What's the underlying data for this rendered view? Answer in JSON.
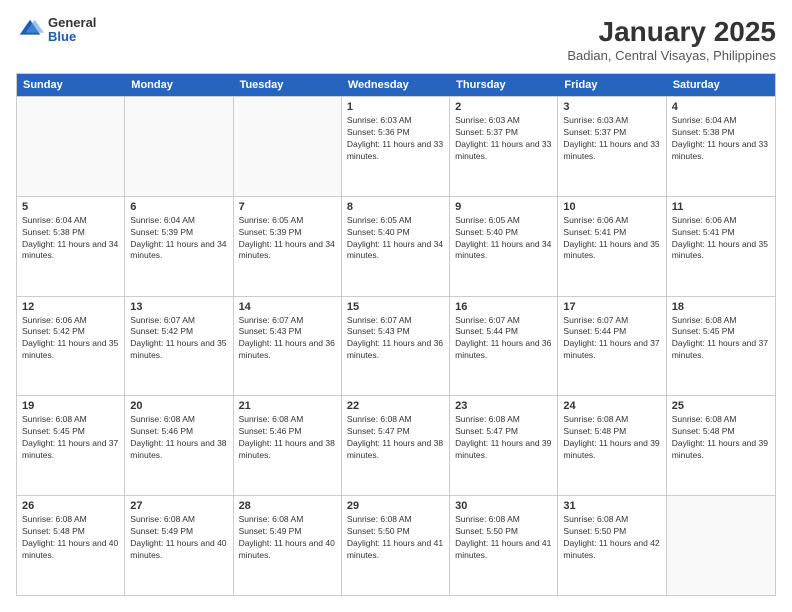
{
  "logo": {
    "general": "General",
    "blue": "Blue"
  },
  "title": "January 2025",
  "location": "Badian, Central Visayas, Philippines",
  "days": [
    "Sunday",
    "Monday",
    "Tuesday",
    "Wednesday",
    "Thursday",
    "Friday",
    "Saturday"
  ],
  "weeks": [
    [
      {
        "date": "",
        "empty": true
      },
      {
        "date": "",
        "empty": true
      },
      {
        "date": "",
        "empty": true
      },
      {
        "date": "1",
        "sunrise": "Sunrise: 6:03 AM",
        "sunset": "Sunset: 5:36 PM",
        "daylight": "Daylight: 11 hours and 33 minutes."
      },
      {
        "date": "2",
        "sunrise": "Sunrise: 6:03 AM",
        "sunset": "Sunset: 5:37 PM",
        "daylight": "Daylight: 11 hours and 33 minutes."
      },
      {
        "date": "3",
        "sunrise": "Sunrise: 6:03 AM",
        "sunset": "Sunset: 5:37 PM",
        "daylight": "Daylight: 11 hours and 33 minutes."
      },
      {
        "date": "4",
        "sunrise": "Sunrise: 6:04 AM",
        "sunset": "Sunset: 5:38 PM",
        "daylight": "Daylight: 11 hours and 33 minutes."
      }
    ],
    [
      {
        "date": "5",
        "sunrise": "Sunrise: 6:04 AM",
        "sunset": "Sunset: 5:38 PM",
        "daylight": "Daylight: 11 hours and 34 minutes."
      },
      {
        "date": "6",
        "sunrise": "Sunrise: 6:04 AM",
        "sunset": "Sunset: 5:39 PM",
        "daylight": "Daylight: 11 hours and 34 minutes."
      },
      {
        "date": "7",
        "sunrise": "Sunrise: 6:05 AM",
        "sunset": "Sunset: 5:39 PM",
        "daylight": "Daylight: 11 hours and 34 minutes."
      },
      {
        "date": "8",
        "sunrise": "Sunrise: 6:05 AM",
        "sunset": "Sunset: 5:40 PM",
        "daylight": "Daylight: 11 hours and 34 minutes."
      },
      {
        "date": "9",
        "sunrise": "Sunrise: 6:05 AM",
        "sunset": "Sunset: 5:40 PM",
        "daylight": "Daylight: 11 hours and 34 minutes."
      },
      {
        "date": "10",
        "sunrise": "Sunrise: 6:06 AM",
        "sunset": "Sunset: 5:41 PM",
        "daylight": "Daylight: 11 hours and 35 minutes."
      },
      {
        "date": "11",
        "sunrise": "Sunrise: 6:06 AM",
        "sunset": "Sunset: 5:41 PM",
        "daylight": "Daylight: 11 hours and 35 minutes."
      }
    ],
    [
      {
        "date": "12",
        "sunrise": "Sunrise: 6:06 AM",
        "sunset": "Sunset: 5:42 PM",
        "daylight": "Daylight: 11 hours and 35 minutes."
      },
      {
        "date": "13",
        "sunrise": "Sunrise: 6:07 AM",
        "sunset": "Sunset: 5:42 PM",
        "daylight": "Daylight: 11 hours and 35 minutes."
      },
      {
        "date": "14",
        "sunrise": "Sunrise: 6:07 AM",
        "sunset": "Sunset: 5:43 PM",
        "daylight": "Daylight: 11 hours and 36 minutes."
      },
      {
        "date": "15",
        "sunrise": "Sunrise: 6:07 AM",
        "sunset": "Sunset: 5:43 PM",
        "daylight": "Daylight: 11 hours and 36 minutes."
      },
      {
        "date": "16",
        "sunrise": "Sunrise: 6:07 AM",
        "sunset": "Sunset: 5:44 PM",
        "daylight": "Daylight: 11 hours and 36 minutes."
      },
      {
        "date": "17",
        "sunrise": "Sunrise: 6:07 AM",
        "sunset": "Sunset: 5:44 PM",
        "daylight": "Daylight: 11 hours and 37 minutes."
      },
      {
        "date": "18",
        "sunrise": "Sunrise: 6:08 AM",
        "sunset": "Sunset: 5:45 PM",
        "daylight": "Daylight: 11 hours and 37 minutes."
      }
    ],
    [
      {
        "date": "19",
        "sunrise": "Sunrise: 6:08 AM",
        "sunset": "Sunset: 5:45 PM",
        "daylight": "Daylight: 11 hours and 37 minutes."
      },
      {
        "date": "20",
        "sunrise": "Sunrise: 6:08 AM",
        "sunset": "Sunset: 5:46 PM",
        "daylight": "Daylight: 11 hours and 38 minutes."
      },
      {
        "date": "21",
        "sunrise": "Sunrise: 6:08 AM",
        "sunset": "Sunset: 5:46 PM",
        "daylight": "Daylight: 11 hours and 38 minutes."
      },
      {
        "date": "22",
        "sunrise": "Sunrise: 6:08 AM",
        "sunset": "Sunset: 5:47 PM",
        "daylight": "Daylight: 11 hours and 38 minutes."
      },
      {
        "date": "23",
        "sunrise": "Sunrise: 6:08 AM",
        "sunset": "Sunset: 5:47 PM",
        "daylight": "Daylight: 11 hours and 39 minutes."
      },
      {
        "date": "24",
        "sunrise": "Sunrise: 6:08 AM",
        "sunset": "Sunset: 5:48 PM",
        "daylight": "Daylight: 11 hours and 39 minutes."
      },
      {
        "date": "25",
        "sunrise": "Sunrise: 6:08 AM",
        "sunset": "Sunset: 5:48 PM",
        "daylight": "Daylight: 11 hours and 39 minutes."
      }
    ],
    [
      {
        "date": "26",
        "sunrise": "Sunrise: 6:08 AM",
        "sunset": "Sunset: 5:48 PM",
        "daylight": "Daylight: 11 hours and 40 minutes."
      },
      {
        "date": "27",
        "sunrise": "Sunrise: 6:08 AM",
        "sunset": "Sunset: 5:49 PM",
        "daylight": "Daylight: 11 hours and 40 minutes."
      },
      {
        "date": "28",
        "sunrise": "Sunrise: 6:08 AM",
        "sunset": "Sunset: 5:49 PM",
        "daylight": "Daylight: 11 hours and 40 minutes."
      },
      {
        "date": "29",
        "sunrise": "Sunrise: 6:08 AM",
        "sunset": "Sunset: 5:50 PM",
        "daylight": "Daylight: 11 hours and 41 minutes."
      },
      {
        "date": "30",
        "sunrise": "Sunrise: 6:08 AM",
        "sunset": "Sunset: 5:50 PM",
        "daylight": "Daylight: 11 hours and 41 minutes."
      },
      {
        "date": "31",
        "sunrise": "Sunrise: 6:08 AM",
        "sunset": "Sunset: 5:50 PM",
        "daylight": "Daylight: 11 hours and 42 minutes."
      },
      {
        "date": "",
        "empty": true
      }
    ]
  ]
}
